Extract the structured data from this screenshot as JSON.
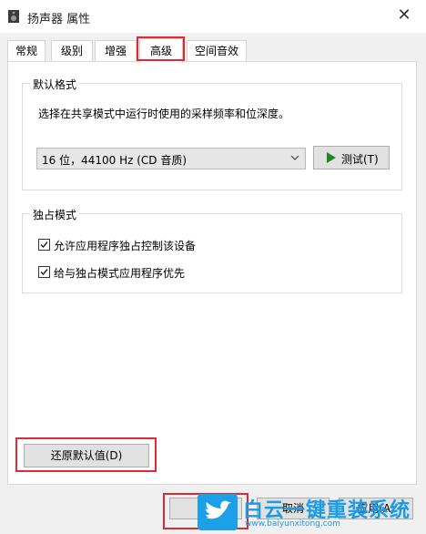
{
  "window": {
    "title": "扬声器 属性",
    "close_glyph": "✕"
  },
  "tabs": [
    {
      "label": "常规"
    },
    {
      "label": "级别"
    },
    {
      "label": "增强"
    },
    {
      "label": "高级",
      "active": true
    },
    {
      "label": "空间音效"
    }
  ],
  "default_format": {
    "group_title": "默认格式",
    "description": "选择在共享模式中运行时使用的采样频率和位深度。",
    "selected": "16 位，44100 Hz (CD 音质)",
    "test_button": "测试(T)"
  },
  "exclusive_mode": {
    "group_title": "独占模式",
    "options": [
      {
        "label": "允许应用程序独占控制该设备",
        "checked": true
      },
      {
        "label": "给与独占模式应用程序优先",
        "checked": true
      }
    ]
  },
  "restore_button": "还原默认值(D)",
  "buttons": {
    "cancel": "取消",
    "apply": "应用(A)"
  },
  "watermark": {
    "title": "白云一键重装系统",
    "url": "www.baiyunxitong.com"
  },
  "colors": {
    "highlight": "#e02a33",
    "accent": "#1a9be6",
    "play_green": "#1e8a1e"
  }
}
